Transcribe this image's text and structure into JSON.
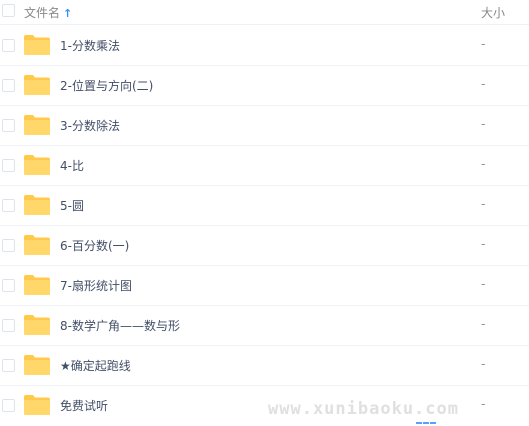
{
  "header": {
    "name_label": "文件名",
    "sort_icon": "↑",
    "size_label": "大小"
  },
  "files": [
    {
      "name": "1-分数乘法",
      "size": "-"
    },
    {
      "name": "2-位置与方向(二)",
      "size": "-"
    },
    {
      "name": "3-分数除法",
      "size": "-"
    },
    {
      "name": "4-比",
      "size": "-"
    },
    {
      "name": "5-圆",
      "size": "-"
    },
    {
      "name": "6-百分数(一)",
      "size": "-"
    },
    {
      "name": "7-扇形统计图",
      "size": "-"
    },
    {
      "name": "8-数学广角——数与形",
      "size": "-"
    },
    {
      "name": "★确定起跑线",
      "size": "-"
    },
    {
      "name": "免费试听",
      "size": "-"
    }
  ],
  "watermark": "www.xunibaoku.com",
  "colors": {
    "folder": "#ffd76a",
    "folder_tab": "#ffc94a",
    "accent": "#3b8cff"
  },
  "icons": {
    "folder": "folder-icon",
    "sort": "sort-arrow-up-icon",
    "checkbox": "checkbox-icon"
  }
}
